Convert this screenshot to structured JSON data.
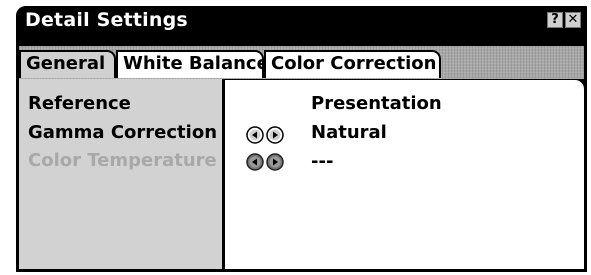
{
  "window": {
    "title": "Detail Settings",
    "help_glyph": "?",
    "close_glyph": "✕"
  },
  "tabs": [
    {
      "label": "General",
      "active": true
    },
    {
      "label": "White Balance",
      "active": false
    },
    {
      "label": "Color Correction",
      "active": false
    }
  ],
  "settings": [
    {
      "label": "Reference",
      "value": "Presentation",
      "enabled": true,
      "has_arrows": false
    },
    {
      "label": "Gamma Correction",
      "value": "Natural",
      "enabled": true,
      "has_arrows": true
    },
    {
      "label": "Color Temperature",
      "value": "---",
      "enabled": false,
      "has_arrows": true
    }
  ],
  "colors": {
    "window_frame": "#000000",
    "left_panel": "#d2d2d2",
    "active_tab": "#d0d0d0",
    "disabled_text": "#a8a8a8"
  },
  "icons": {
    "adjust": "left-right-arrow-icon"
  }
}
